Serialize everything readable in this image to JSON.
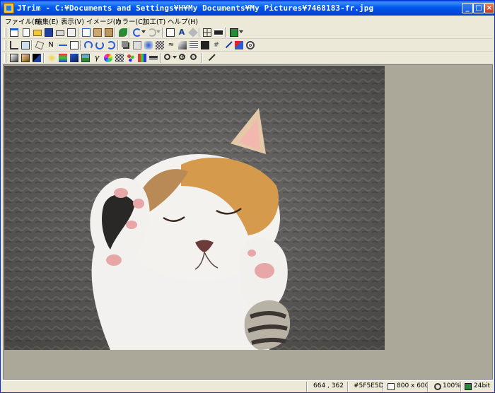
{
  "window": {
    "title": "JTrim - C:¥Documents and Settings¥H¥My Documents¥My Pictures¥7468183-fr.jpg",
    "controls": {
      "minimize": "_",
      "maximize": "□",
      "close": "×"
    }
  },
  "menu": [
    {
      "label": "ファイル(F)"
    },
    {
      "label": "編集(E)"
    },
    {
      "label": "表示(V)"
    },
    {
      "label": "イメージ(I)"
    },
    {
      "label": "カラー(C)"
    },
    {
      "label": "加工(T)"
    },
    {
      "label": "ヘルプ(H)"
    }
  ],
  "toolbar1": [
    "window-new-icon",
    "new-file-icon",
    "open-folder-icon",
    "save-icon",
    "print-icon",
    "print-preview-icon",
    "copy-icon",
    "paste-icon",
    "paste-new-icon",
    "capture-icon",
    "undo-icon",
    "redo-icon",
    "fit-window-icon",
    "text-icon",
    "shape-icon",
    "grid-icon",
    "filmstrip-icon",
    "layout-icon"
  ],
  "toolbar2": [
    "crop-icon",
    "resize-icon",
    "rotate-free-icon",
    "flip-icon",
    "mirror-icon",
    "trim-icon",
    "rotate-left-icon",
    "rotate-right-icon",
    "rotate-icon",
    "shadow-icon",
    "border-icon",
    "blur-icon",
    "mosaic-icon",
    "wave-icon",
    "emboss-icon",
    "scanline-icon",
    "frame-icon",
    "sharpen-icon",
    "pen-icon",
    "color-pen-icon",
    "spiral-icon"
  ],
  "toolbar3": [
    "grayscale-icon",
    "sepia-icon",
    "negative-icon",
    "brightness-icon",
    "color-balance-icon",
    "contrast-icon",
    "histogram-icon",
    "gamma-icon",
    "rgb-icon",
    "dither-icon",
    "reduce-color-icon",
    "palette-icon",
    "levels-icon",
    "zoom-icon",
    "zoom-in-icon",
    "zoom-out-icon",
    "eyedropper-icon"
  ],
  "colors": {
    "title_bar": "#0054e3",
    "canvas_bg": "#aca899",
    "chrome": "#ece9d8"
  },
  "status": {
    "coordinates": "664 , 362",
    "pixel_color": "#5F5E5D",
    "image_size": "800 x 600",
    "zoom": "100%",
    "bit_depth": "24bit"
  }
}
